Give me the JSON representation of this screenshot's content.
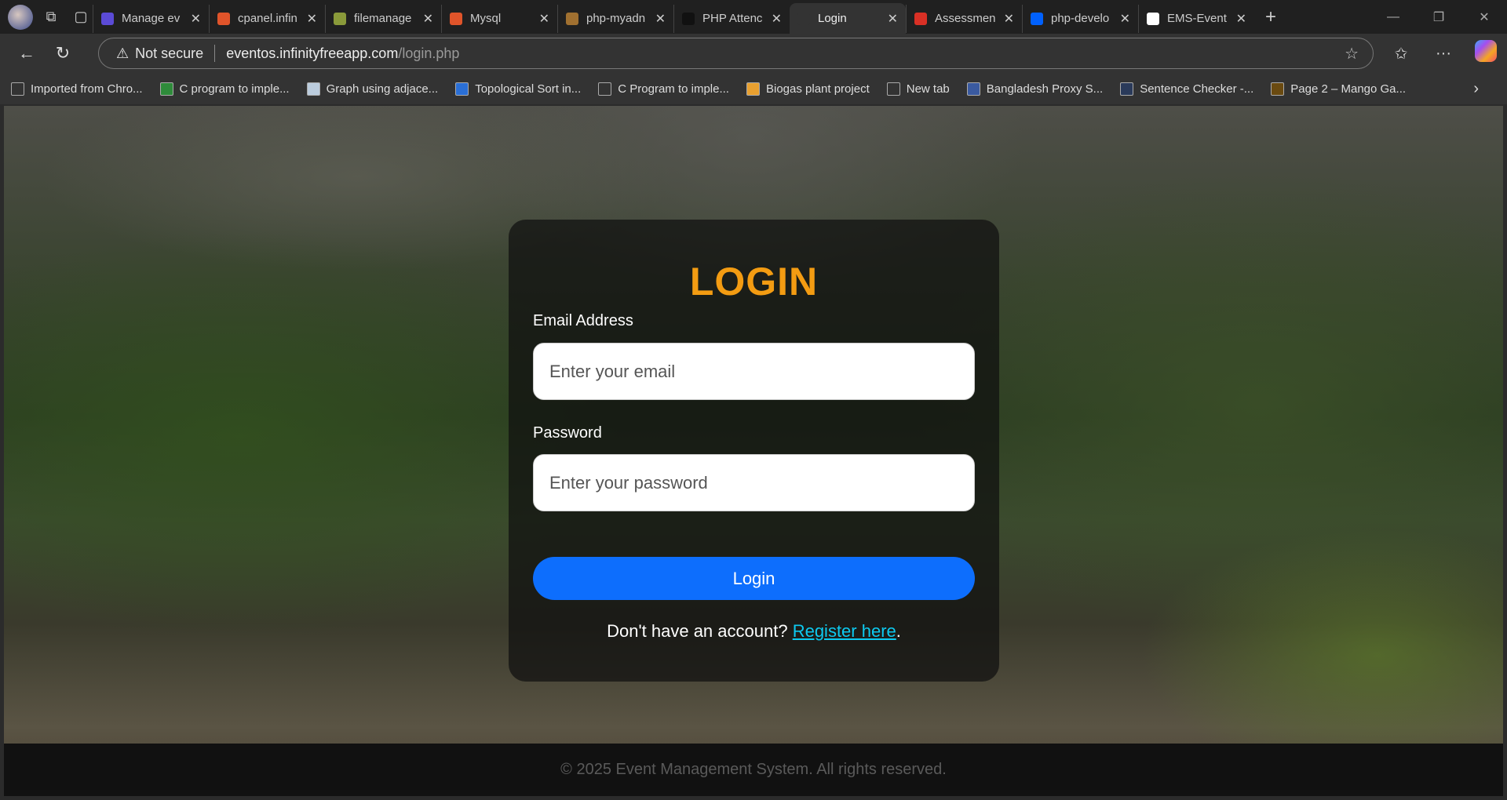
{
  "browser": {
    "tabs": [
      {
        "title": "Manage ev",
        "favicon_color": "#5b4bd6"
      },
      {
        "title": "cpanel.infin",
        "favicon_color": "#e0542a"
      },
      {
        "title": "filemanage",
        "favicon_color": "#8a9a3a"
      },
      {
        "title": "Mysql",
        "favicon_color": "#e0542a"
      },
      {
        "title": "php-myadn",
        "favicon_color": "#a07030"
      },
      {
        "title": "PHP Attenc",
        "favicon_color": "#111111"
      },
      {
        "title": "Login",
        "favicon_color": "#333333",
        "active": true
      },
      {
        "title": "Assessmen",
        "favicon_color": "#d93025"
      },
      {
        "title": "php-develo",
        "favicon_color": "#0061fe"
      },
      {
        "title": "EMS-Event",
        "favicon_color": "#ffffff"
      }
    ],
    "address": {
      "security": "Not secure",
      "host": "eventos.infinityfreeapp.com",
      "path": "/login.php"
    },
    "bookmarks": [
      {
        "label": "Imported from Chro...",
        "icon_color": "#333333"
      },
      {
        "label": "C program to imple...",
        "icon_color": "#2e8b3a"
      },
      {
        "label": "Graph using adjace...",
        "icon_color": "#bcd"
      },
      {
        "label": "Topological Sort in...",
        "icon_color": "#2a6fd6"
      },
      {
        "label": "C Program to imple...",
        "icon_color": "#333333"
      },
      {
        "label": "Biogas plant project",
        "icon_color": "#e8a030"
      },
      {
        "label": "New tab",
        "icon_color": "#333333"
      },
      {
        "label": "Bangladesh Proxy S...",
        "icon_color": "#3a5aa0"
      },
      {
        "label": "Sentence Checker -...",
        "icon_color": "#2a3a5a"
      },
      {
        "label": "Page 2 – Mango Ga...",
        "icon_color": "#6a4a10"
      }
    ]
  },
  "login": {
    "title": "LOGIN",
    "email_label": "Email Address",
    "email_placeholder": "Enter your email",
    "email_value": "",
    "password_label": "Password",
    "password_placeholder": "Enter your password",
    "password_value": "",
    "button_label": "Login",
    "register_prompt": "Don't have an account?",
    "register_link": "Register here",
    "register_suffix": "."
  },
  "footer": {
    "text": "© 2025 Event Management System. All rights reserved."
  },
  "colors": {
    "title": "#f39c12",
    "button": "#0d6efd",
    "link": "#0dcaf0"
  }
}
